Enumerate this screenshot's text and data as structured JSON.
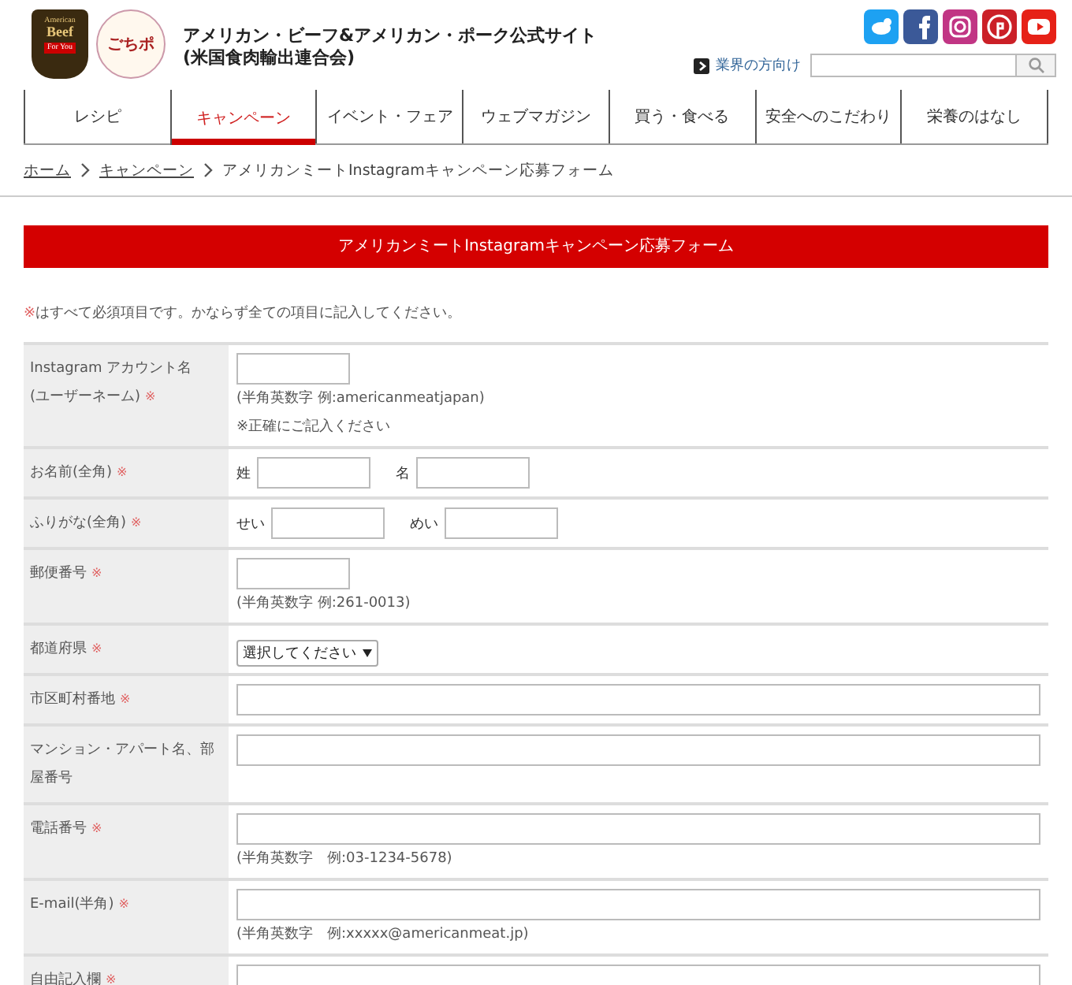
{
  "header": {
    "logo_beef": [
      "American",
      "Beef",
      "For You"
    ],
    "logo_gochipo": "ごちポ",
    "site_title": [
      "アメリカン・ビーフ&アメリカン・ポーク公式サイト",
      "(米国食肉輸出連合会)"
    ],
    "social": [
      {
        "kind": "bird",
        "color": "#1da1f2"
      },
      {
        "kind": "f",
        "color": "#3b5998"
      },
      {
        "kind": "camera",
        "color": "#c13584"
      },
      {
        "kind": "pin",
        "color": "#cb2027"
      },
      {
        "kind": "play",
        "color": "#e62117"
      }
    ],
    "trade_link": "業界の方向け"
  },
  "nav": [
    {
      "label": "レシピ",
      "selected": false
    },
    {
      "label": "キャンペーン",
      "selected": true
    },
    {
      "label": "イベント・フェア",
      "selected": false
    },
    {
      "label": "ウェブマガジン",
      "selected": false
    },
    {
      "label": "買う・食べる",
      "selected": false
    },
    {
      "label": "安全へのこだわり",
      "selected": false
    },
    {
      "label": "栄養のはなし",
      "selected": false
    }
  ],
  "breadcrumb": [
    {
      "label": "ホーム",
      "link": true
    },
    {
      "label": "キャンペーン",
      "link": true
    },
    {
      "label": "アメリカンミートInstagramキャンペーン応募フォーム",
      "link": false
    }
  ],
  "banner": "アメリカンミートInstagramキャンペーン応募フォーム",
  "note": {
    "mark": "※",
    "text": "はすべて必須項目です。かならず全ての項目に記入してください。"
  },
  "rows": [
    {
      "label": [
        "Instagram アカウント名",
        "(ユーザーネーム)"
      ],
      "mark": "※",
      "kind": "short",
      "notes": [
        "(半角英数字 例:americanmeatjapan)",
        "※正確にご記入ください"
      ]
    },
    {
      "label": [
        "お名前(全角)"
      ],
      "mark": "※",
      "kind": "pair",
      "parts": [
        "姓",
        "名"
      ]
    },
    {
      "label": [
        "ふりがな(全角)"
      ],
      "mark": "※",
      "kind": "pair",
      "parts": [
        "せい",
        "めい"
      ]
    },
    {
      "label": [
        "郵便番号"
      ],
      "mark": "※",
      "kind": "short",
      "notes": [
        "(半角英数字 例:261-0013)"
      ]
    },
    {
      "label": [
        "都道府県"
      ],
      "mark": "※",
      "kind": "select",
      "value": "選択してください"
    },
    {
      "label": [
        "市区町村番地"
      ],
      "mark": "※",
      "kind": "wide",
      "notes": []
    },
    {
      "label": [
        "マンション・アパート名、部屋番号"
      ],
      "kind": "wide",
      "notes": []
    },
    {
      "label": [
        "電話番号"
      ],
      "mark": "※",
      "kind": "wide",
      "notes": [
        "(半角英数字　例:03-1234-5678)"
      ]
    },
    {
      "label": [
        "E-mail(半角)"
      ],
      "mark": "※",
      "kind": "wide",
      "notes": [
        "(半角英数字　例:xxxxx@americanmeat.jp)"
      ]
    },
    {
      "label": [
        "自由記入欄"
      ],
      "mark": "※",
      "kind": "wide",
      "notes": []
    }
  ]
}
